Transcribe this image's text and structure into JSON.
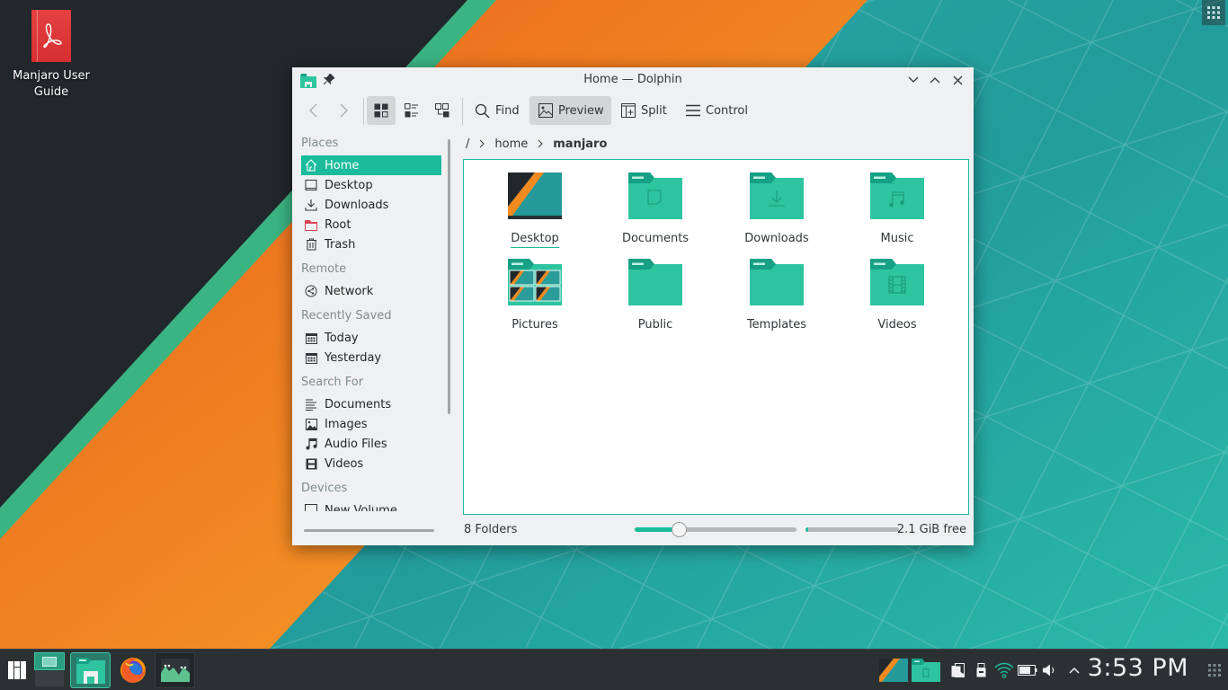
{
  "desktop": {
    "icons": [
      {
        "label": "Manjaro User Guide",
        "icon": "pdf-document-icon"
      }
    ]
  },
  "window": {
    "title": "Home — Dolphin",
    "titlebar_buttons": [
      "minimize",
      "maximize",
      "close"
    ],
    "toolbar": {
      "back_label": "Back",
      "forward_label": "Forward",
      "view_modes": [
        {
          "name": "icons",
          "active": true
        },
        {
          "name": "compact",
          "active": false
        },
        {
          "name": "details",
          "active": false
        }
      ],
      "find_label": "Find",
      "preview_label": "Preview",
      "preview_active": true,
      "split_label": "Split",
      "control_label": "Control"
    },
    "sidebar": {
      "sections": [
        {
          "header": "Places",
          "items": [
            {
              "label": "Home",
              "icon": "home-icon",
              "selected": true
            },
            {
              "label": "Desktop",
              "icon": "desktop-icon"
            },
            {
              "label": "Downloads",
              "icon": "download-icon"
            },
            {
              "label": "Root",
              "icon": "root-folder-icon"
            },
            {
              "label": "Trash",
              "icon": "trash-icon"
            }
          ]
        },
        {
          "header": "Remote",
          "items": [
            {
              "label": "Network",
              "icon": "network-icon"
            }
          ]
        },
        {
          "header": "Recently Saved",
          "items": [
            {
              "label": "Today",
              "icon": "calendar-icon"
            },
            {
              "label": "Yesterday",
              "icon": "calendar-icon"
            }
          ]
        },
        {
          "header": "Search For",
          "items": [
            {
              "label": "Documents",
              "icon": "document-lines-icon"
            },
            {
              "label": "Images",
              "icon": "image-icon"
            },
            {
              "label": "Audio Files",
              "icon": "music-note-icon"
            },
            {
              "label": "Videos",
              "icon": "film-icon"
            }
          ]
        },
        {
          "header": "Devices",
          "items": [
            {
              "label": "New Volume",
              "icon": "drive-icon"
            }
          ]
        }
      ]
    },
    "breadcrumb": [
      "/",
      "home",
      "manjaro"
    ],
    "files": [
      {
        "name": "Desktop",
        "type": "desktop-preview",
        "focused": true
      },
      {
        "name": "Documents",
        "type": "folder-documents"
      },
      {
        "name": "Downloads",
        "type": "folder-downloads"
      },
      {
        "name": "Music",
        "type": "folder-music"
      },
      {
        "name": "Pictures",
        "type": "folder-pictures"
      },
      {
        "name": "Public",
        "type": "folder"
      },
      {
        "name": "Templates",
        "type": "folder"
      },
      {
        "name": "Videos",
        "type": "folder-videos"
      }
    ],
    "statusbar": {
      "summary": "8 Folders",
      "zoom_level_fraction": 0.27,
      "disk_used_fraction": 0.03,
      "free_space": "2.1 GiB free"
    }
  },
  "taskbar": {
    "launcher": "application-menu-icon",
    "tasks": [
      {
        "name": "pager-desktop",
        "active": false
      },
      {
        "name": "dolphin",
        "active": true
      },
      {
        "name": "firefox",
        "active": false
      },
      {
        "name": "system-monitor",
        "active": false
      }
    ],
    "tray": [
      "wallpaper-thumbnail",
      "trash-folder",
      "clipboard",
      "usb-device",
      "wifi",
      "battery",
      "volume",
      "expand-arrow"
    ],
    "clock": "3:53 PM"
  },
  "colors": {
    "accent": "#1abc9c",
    "folder": "#2ec4a0",
    "orange": "#f28a1f",
    "panel": "#2b3133"
  }
}
